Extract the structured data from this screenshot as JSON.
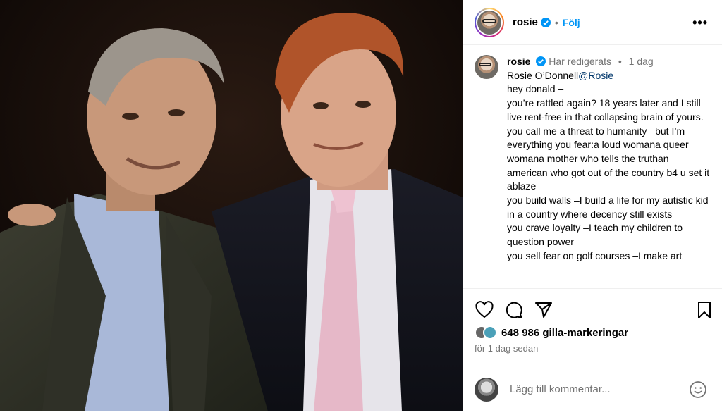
{
  "header": {
    "username": "rosie",
    "separator": "•",
    "follow_label": "Följ",
    "more_icon": "more-horizontal-icon"
  },
  "caption": {
    "username": "rosie",
    "edited_label": "Har redigerats",
    "separator": "•",
    "time": "1 dag",
    "display_name": "Rosie O’Donnell",
    "mention": "@Rosie",
    "lines": [
      "hey donald –",
      "you’re rattled again? 18 years later and I still live rent-free in that collapsing brain of yours.",
      "you call me a threat to humanity –but I’m everything you fear:a loud womana queer womana mother who tells the truthan american who got out of the country b4 u set it ablaze",
      "you build walls –I build a life for my autistic kid in a country where decency still exists",
      "you crave loyalty –I teach my children to question power",
      "you sell fear on golf courses –I make art"
    ]
  },
  "actions": {
    "like_icon": "heart-icon",
    "comment_icon": "comment-icon",
    "share_icon": "send-icon",
    "save_icon": "bookmark-icon"
  },
  "likes": {
    "count_label": "648 986 gilla-markeringar"
  },
  "timestamp": "för 1 dag sedan",
  "comment": {
    "placeholder": "Lägg till kommentar...",
    "emoji_icon": "smiley-icon"
  },
  "colors": {
    "link": "#0095f6",
    "mention": "#00376b",
    "verified": "#0095f6",
    "muted": "#737373"
  }
}
